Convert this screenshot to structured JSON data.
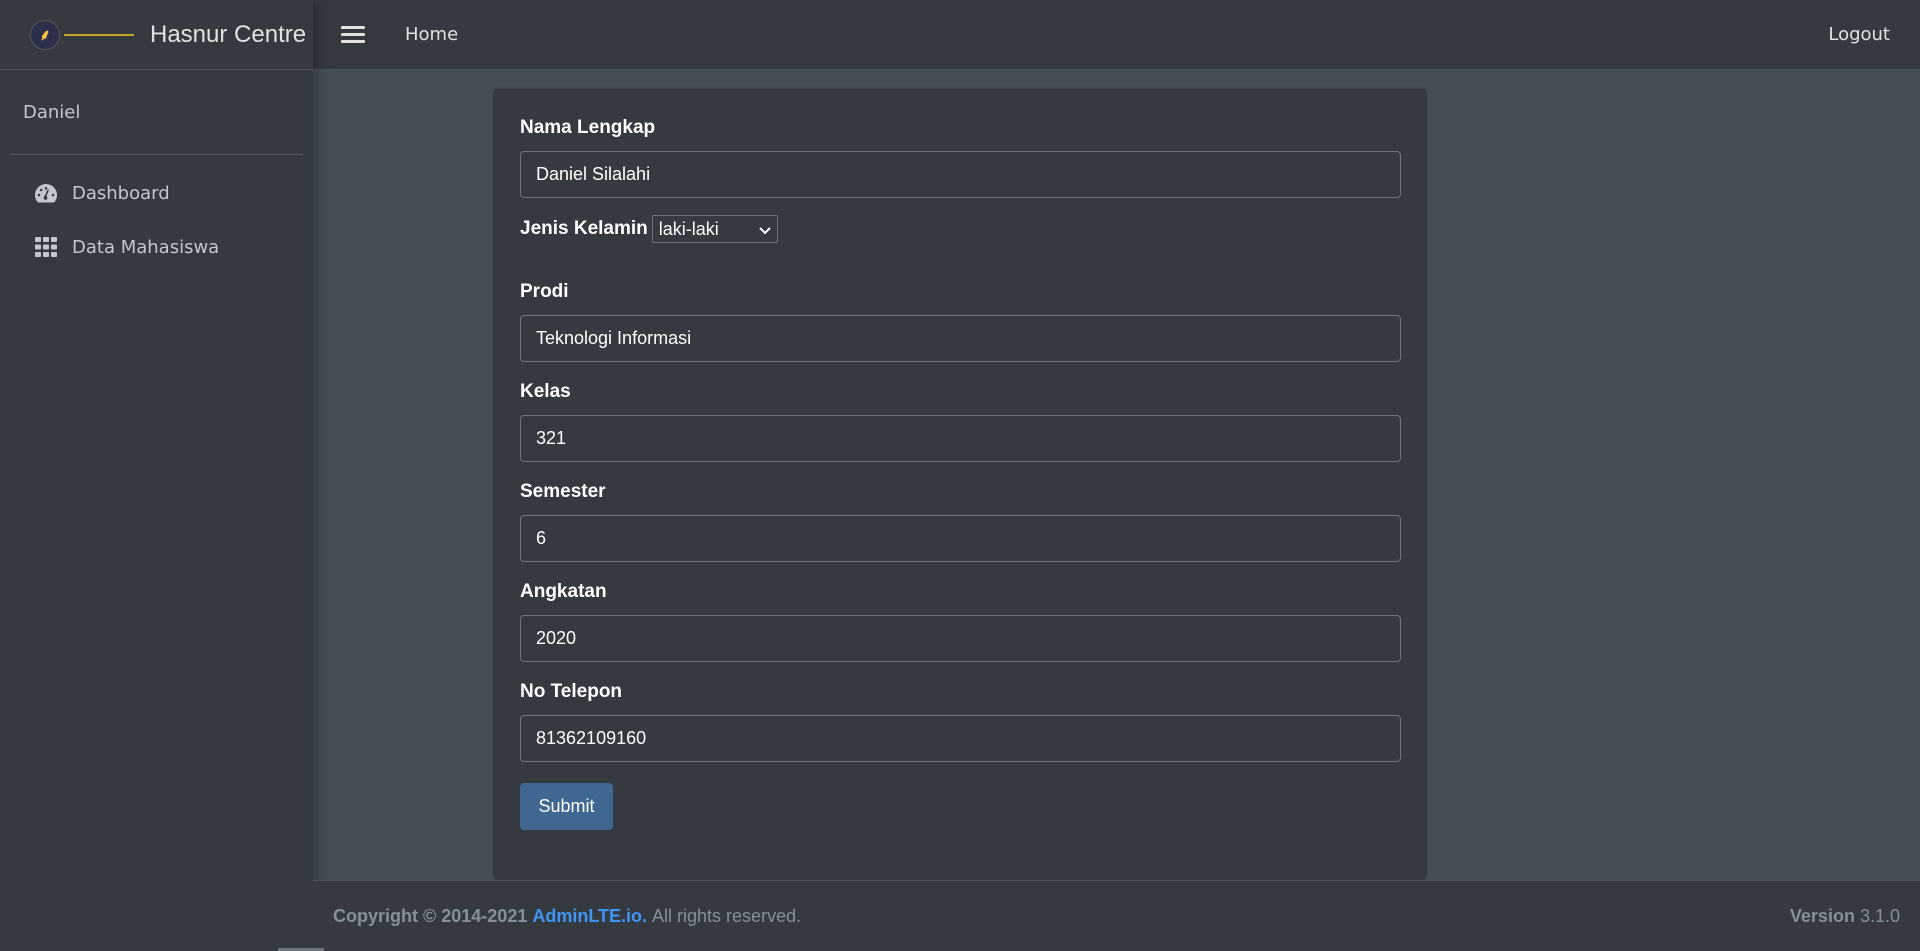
{
  "brand": {
    "name": "Hasnur Centre",
    "logo_icon": "flame-logo-icon"
  },
  "user": {
    "name": "Daniel"
  },
  "sidebar": {
    "items": [
      {
        "label": "Dashboard",
        "icon": "tachometer-icon"
      },
      {
        "label": "Data Mahasiswa",
        "icon": "grid-icon"
      }
    ]
  },
  "navbar": {
    "home": "Home",
    "logout": "Logout"
  },
  "form": {
    "nama": {
      "label": "Nama Lengkap",
      "value": "Daniel Silalahi"
    },
    "gender": {
      "label": "Jenis Kelamin",
      "value": "laki-laki"
    },
    "prodi": {
      "label": "Prodi",
      "value": "Teknologi Informasi"
    },
    "kelas": {
      "label": "Kelas",
      "value": "321"
    },
    "semester": {
      "label": "Semester",
      "value": "6"
    },
    "angkatan": {
      "label": "Angkatan",
      "value": "2020"
    },
    "telepon": {
      "label": "No Telepon",
      "value": "81362109160"
    },
    "submit": "Submit"
  },
  "footer": {
    "copyright": "Copyright © 2014-2021",
    "link": "AdminLTE.io.",
    "rights": "All rights reserved.",
    "version_label": "Version",
    "version": "3.1.0"
  },
  "colors": {
    "accent": "#3f6791",
    "link": "#3f94f5",
    "panel": "#343a40",
    "background": "#454d55"
  }
}
